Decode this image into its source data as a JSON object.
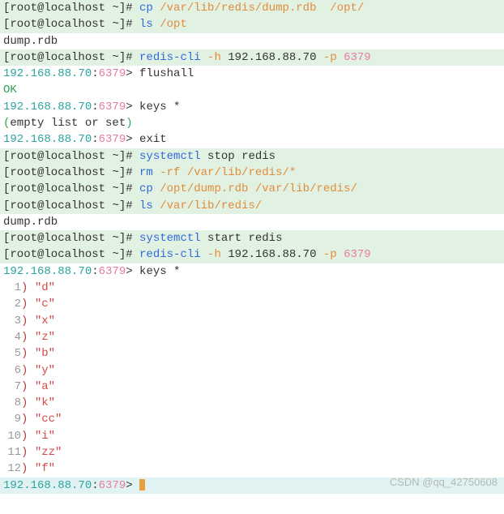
{
  "prompt": "[root@localhost ~]# ",
  "redis_prompt_host": "192.168.88.70",
  "redis_prompt_port": "6379",
  "redis_prompt_sep": ":",
  "redis_prompt_gt": "> ",
  "cmd": {
    "cp1_c": "cp",
    "cp1_a": " /var/lib/redis/dump.rdb  /opt/",
    "ls1_c": "ls",
    "ls1_a": " /opt",
    "redcli_c": "redis-cli",
    "h_flag": " -h ",
    "h_val": "192.168.88.70",
    "p_flag": " -p ",
    "p_val": "6379",
    "flushall": "flushall",
    "ok": "OK",
    "keys_c": "keys",
    "keys_a": " *",
    "empty_l": "(",
    "empty_mid": "empty list or set",
    "empty_r": ")",
    "exit": "exit",
    "sysctl": "systemctl",
    "stop_r": " stop redis",
    "rm_c": "rm",
    "rm_a": " -rf /var/lib/redis/*",
    "cp2_c": "cp",
    "cp2_a": " /opt/dump.rdb /var/lib/redis/",
    "ls2_c": "ls",
    "ls2_a": " /var/lib/redis/",
    "start_r": " start redis"
  },
  "out": {
    "dump": "dump.rdb"
  },
  "keys": [
    {
      "n": "1",
      "v": "\"d\""
    },
    {
      "n": "2",
      "v": "\"c\""
    },
    {
      "n": "3",
      "v": "\"x\""
    },
    {
      "n": "4",
      "v": "\"z\""
    },
    {
      "n": "5",
      "v": "\"b\""
    },
    {
      "n": "6",
      "v": "\"y\""
    },
    {
      "n": "7",
      "v": "\"a\""
    },
    {
      "n": "8",
      "v": "\"k\""
    },
    {
      "n": "9",
      "v": "\"cc\""
    },
    {
      "n": "10",
      "v": "\"i\""
    },
    {
      "n": "11",
      "v": "\"zz\""
    },
    {
      "n": "12",
      "v": "\"f\""
    }
  ],
  "paren": ")",
  "space": " ",
  "watermark": "CSDN @qq_42750608"
}
